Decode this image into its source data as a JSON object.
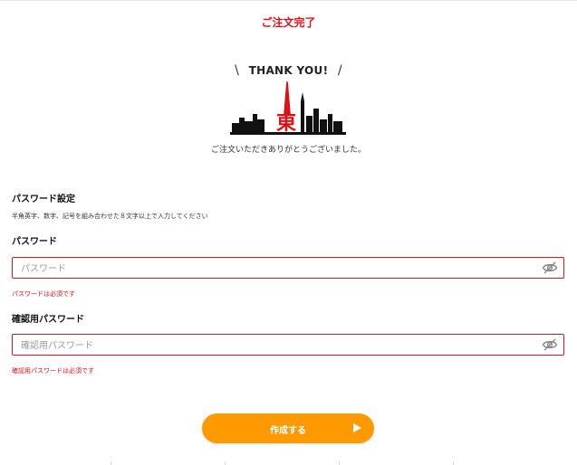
{
  "header": {
    "title": "ご注文完了"
  },
  "hero": {
    "thankyou_text": "THANK YOU!",
    "slash_left": "\\",
    "slash_right": "/",
    "logo_char": "東",
    "message": "ご注文いただきありがとうございました。"
  },
  "form": {
    "section_title": "パスワード設定",
    "hint": "半角英字、数字、記号を組み合わせた８文字以上で入力してください",
    "password": {
      "label": "パスワード",
      "placeholder": "パスワード",
      "value": "",
      "error": "パスワードは必須です"
    },
    "confirm": {
      "label": "確認用パスワード",
      "placeholder": "確認用パスワード",
      "value": "",
      "error": "確認用パスワードは必須です"
    },
    "submit_label": "作成する"
  },
  "icons": {
    "visibility_toggle": "eye-slash-icon",
    "submit_arrow": "play-arrow-icon",
    "logo": "tokyo-skyline-logo"
  },
  "colors": {
    "accent_red": "#d8141b",
    "error_border": "#c3202a",
    "button_orange": "#ff9900",
    "skyline": "#111111"
  }
}
